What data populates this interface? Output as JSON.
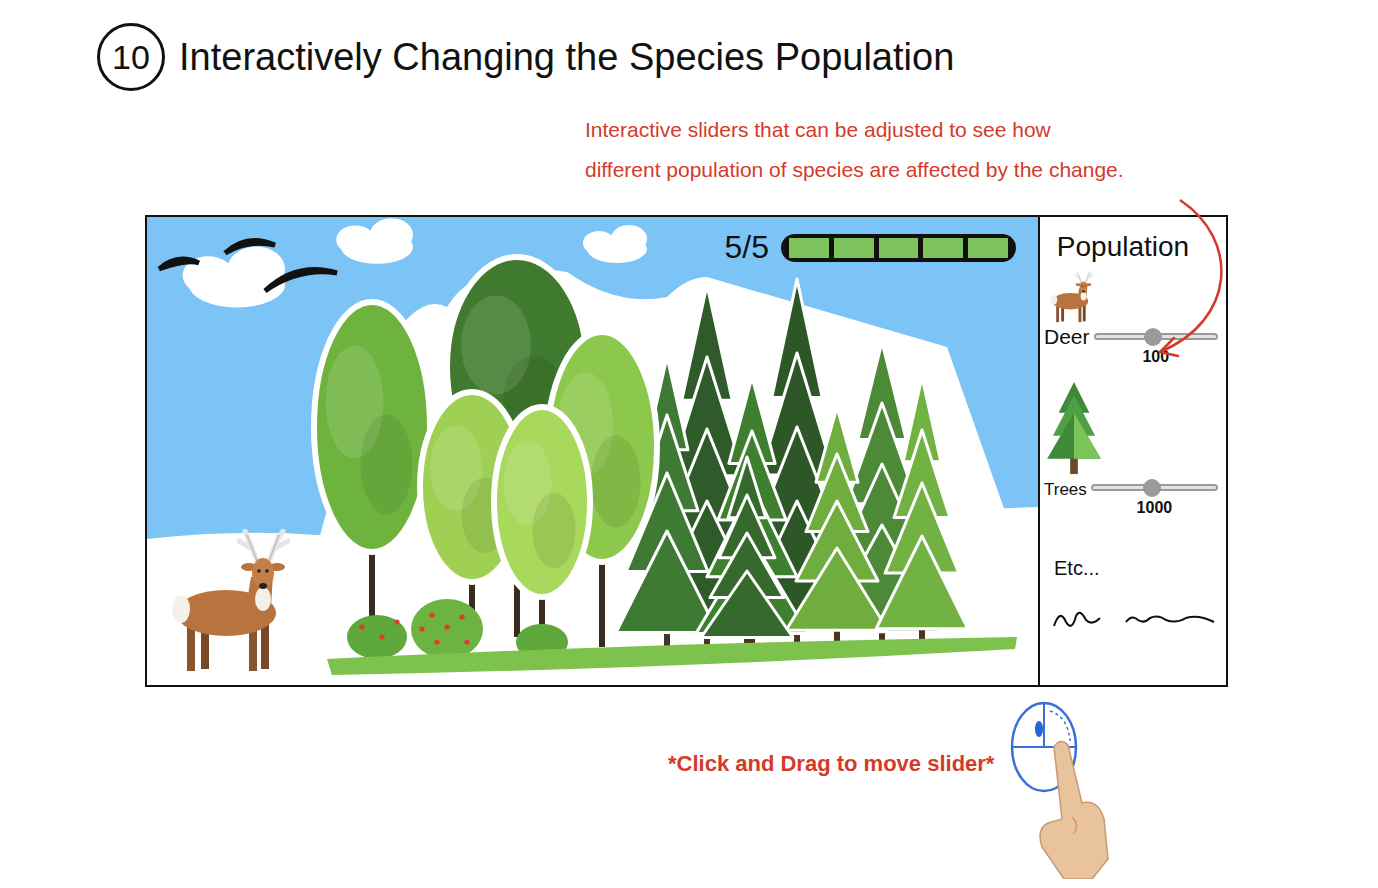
{
  "header": {
    "number": "10",
    "title": "Interactively Changing the Species Population"
  },
  "annotation": {
    "lines": [
      "Interactive sliders that can be adjusted to see how",
      "different population of species are affected by the change."
    ]
  },
  "game": {
    "progress": {
      "reading": "5/5",
      "level": 1,
      "segments": [
        {
          "filled": true
        },
        {
          "filled": true
        },
        {
          "filled": true
        },
        {
          "filled": true
        },
        {
          "filled": true
        }
      ]
    }
  },
  "population_panel": {
    "title": "Population",
    "sliders": [
      {
        "name": "Deer",
        "kind": "deer",
        "level": 0.48,
        "reading": "100"
      },
      {
        "name": "Trees",
        "kind": "tree",
        "level": 0.48,
        "reading": "1000"
      }
    ],
    "more": "Etc..."
  },
  "hint": "*Click and Drag to move slider*"
}
